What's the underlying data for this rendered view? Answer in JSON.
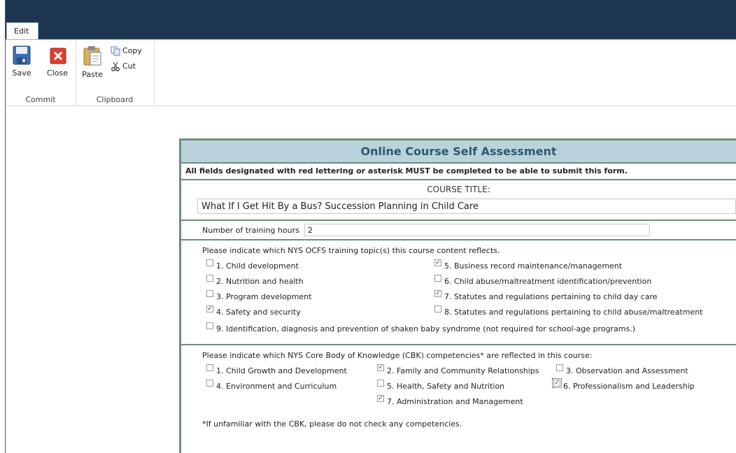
{
  "ribbon": {
    "tab": "Edit",
    "commit": {
      "label": "Commit",
      "save": "Save",
      "close": "Close"
    },
    "clipboard": {
      "label": "Clipboard",
      "paste": "Paste",
      "copy": "Copy",
      "cut": "Cut"
    }
  },
  "form": {
    "title": "Online Course Self Assessment",
    "notice": "All fields designated with red lettering or asterisk MUST be completed to be able to submit this form.",
    "course_title_label": "COURSE TITLE:",
    "course_title_value": "What If I Get Hit By a Bus? Succession Planning in Child Care",
    "hours_label": "Number of training hours",
    "hours_value": "2",
    "topics_intro": "Please indicate which NYS OCFS training topic(s) this course content reflects.",
    "topics": [
      {
        "label": "1. Child development",
        "checked": false
      },
      {
        "label": "2. Nutrition and health",
        "checked": false
      },
      {
        "label": "3. Program development",
        "checked": false
      },
      {
        "label": "4. Safety and security",
        "checked": true
      },
      {
        "label": "5. Business record maintenance/management",
        "checked": true
      },
      {
        "label": "6. Child abuse/maltreatment identification/prevention",
        "checked": false
      },
      {
        "label": "7. Statutes and regulations pertaining to child day care",
        "checked": true
      },
      {
        "label": "8. Statutes and regulations pertaining to child abuse/maltreatment",
        "checked": false
      },
      {
        "label": "9. Identification, diagnosis and prevention of shaken baby syndrome (not required for school-age programs.)",
        "checked": false
      }
    ],
    "cbk_intro": "Please indicate which NYS Core Body of Knowledge (CBK) competencies* are reflected in this course:",
    "cbk": [
      {
        "label": "1. Child Growth and Development",
        "checked": false
      },
      {
        "label": "2. Family and Community Relationships",
        "checked": true
      },
      {
        "label": "3. Observation and Assessment",
        "checked": false
      },
      {
        "label": "4. Environment and Curriculum",
        "checked": false
      },
      {
        "label": "5. Health, Safety and Nutrition",
        "checked": false
      },
      {
        "label": "6. Professionalism and Leadership",
        "checked": true
      },
      {
        "label": "7. Administration and Management",
        "checked": true
      }
    ],
    "footnote": "*If unfamiliar with the CBK, please do not check any competencies."
  },
  "colors": {
    "topbar": "#1e3650",
    "title_band": "#b9d2dc",
    "title_text": "#2c5a70",
    "form_border": "#6b8f7b"
  }
}
